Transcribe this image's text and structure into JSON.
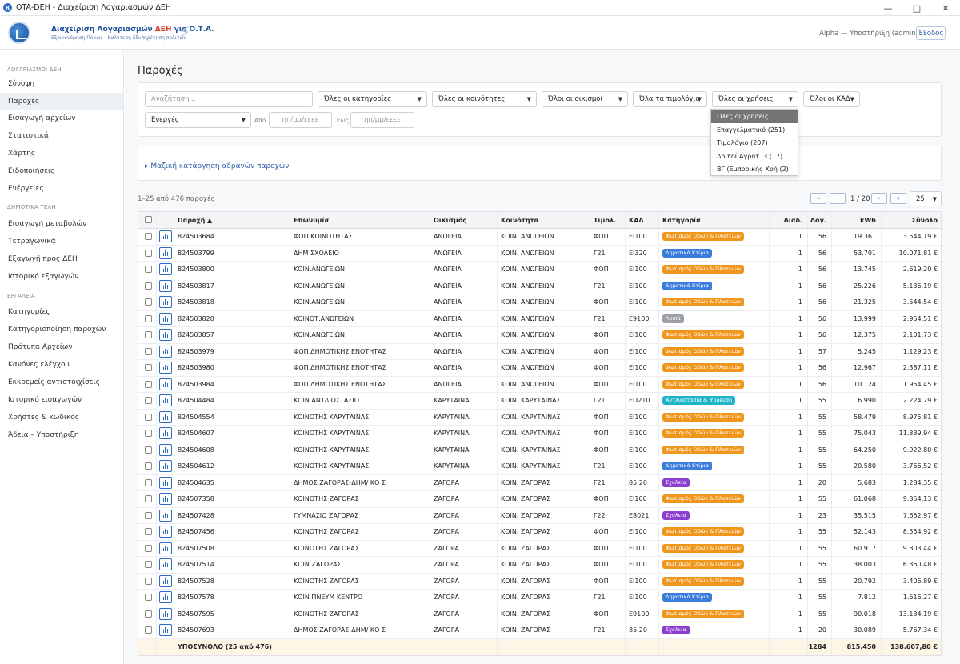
{
  "window": {
    "title": "OTA-DEH - Διαχείριση Λογαριασμών ΔΕΗ"
  },
  "header": {
    "brand_title_a": "Διαχείριση Λογαριασμών ",
    "brand_title_b": "ΔΕΗ",
    "brand_title_c": " για Ο.Τ.Α.",
    "brand_subtitle": "Εξοικονόμηση Πόρων - Καλύτερη Εξυπηρέτηση πολιτών",
    "user": "Alpha — Υποστήριξη (admin)",
    "logout": "Έξοδος"
  },
  "sidebar": {
    "sections": [
      {
        "title": "ΛΟΓΑΡΙΑΣΜΟΙ ΔΕΗ"
      },
      {
        "title": "ΔΗΜΟΤΙΚΑ ΤΕΛΗ"
      },
      {
        "title": "ΕΡΓΑΛΕΙΑ"
      }
    ],
    "items": [
      "Σύνοψη",
      "Παροχές",
      "Εισαγωγή αρχείων",
      "Στατιστικά",
      "Χάρτης",
      "Ειδοποιήσεις",
      "Ενέργειες",
      "Εισαγωγή μεταβολών",
      "Τετραγωνικά",
      "Εξαγωγή προς ΔΕΗ",
      "Ιστορικό εξαγωγών",
      "Κατηγορίες",
      "Κατηγοριοποίηση παροχών",
      "Πρότυπα Αρχείων",
      "Κανόνες ελέγχου",
      "Εκκρεμείς αντιστοιχίσεις",
      "Ιστορικό εισαγωγών",
      "Χρήστες & κωδικός",
      "Άδεια – Υποστήριξη"
    ]
  },
  "page": {
    "title": "Παροχές"
  },
  "filters": {
    "search_placeholder": "Αναζήτηση...",
    "categories": "Όλες οι κατηγορίες",
    "communities": "Όλες οι κοινότητες",
    "settlements": "Όλοι οι οικισμοί",
    "tariffs": "Όλα τα τιμολόγια",
    "uses": "Όλες οι χρήσεις",
    "kad": "Όλοι οι ΚΑΔ",
    "status": "Ενεργές",
    "from_label": "Από",
    "to_label": "Έως",
    "date_placeholder": "ηη/μμ/εεεε"
  },
  "uses_dropdown": [
    "Όλες οι χρήσεις",
    "Επαγγελματικό (251)",
    "Τιμολόγιο (207)",
    "Λοιποί Αγρότ. 3 (17)",
    "ΒΓ (Εμπορικής Χρή (2)"
  ],
  "bulk_link": "▸ Μαζική κατάργηση αδρανών παροχών",
  "listing": {
    "count": "1–25 από 476 παροχές",
    "page": "1 / 20",
    "page_size": "25",
    "first": "«",
    "prev": "‹",
    "next": "›",
    "last": "»"
  },
  "table": {
    "columns": [
      "Παροχή ▲",
      "Επωνυμία",
      "Οικισμός",
      "Κοινότητα",
      "Τιμολ.",
      "ΚΑΔ",
      "Κατηγορία",
      "Διαδ.",
      "Λογ.",
      "kWh",
      "Σύνολο"
    ],
    "rows": [
      [
        "824503684",
        "ΦΟΠ ΚΟΙΝΟΤΗΤΑΣ",
        "ΑΝΩΓΕΙΑ",
        "ΚΟΙΝ. ΑΝΩΓΕΙΩΝ",
        "ΦΟΠ",
        "ΕΙ100",
        "Φωτισμός Οδών & Πλατειών",
        "1",
        "56",
        "19.361",
        "3.544,19 €"
      ],
      [
        "824503799",
        "ΔΗΜ ΣΧΟΛΕΙΟ",
        "ΑΝΩΓΕΙΑ",
        "ΚΟΙΝ. ΑΝΩΓΕΙΩΝ",
        "Γ21",
        "ΕΙ320",
        "Δημοτικά Κτίρια",
        "1",
        "56",
        "53.701",
        "10.071,81 €"
      ],
      [
        "824503800",
        "ΚΟΙΝ.ΑΝΩΓΕΙΩΝ",
        "ΑΝΩΓΕΙΑ",
        "ΚΟΙΝ. ΑΝΩΓΕΙΩΝ",
        "ΦΟΠ",
        "ΕΙ100",
        "Φωτισμός Οδών & Πλατειών",
        "1",
        "56",
        "13.745",
        "2.619,20 €"
      ],
      [
        "824503817",
        "ΚΟΙΝ.ΑΝΩΓΕΙΩΝ",
        "ΑΝΩΓΕΙΑ",
        "ΚΟΙΝ. ΑΝΩΓΕΙΩΝ",
        "Γ21",
        "ΕΙ100",
        "Δημοτικά Κτίρια",
        "1",
        "56",
        "25.226",
        "5.136,19 €"
      ],
      [
        "824503818",
        "ΚΟΙΝ.ΑΝΩΓΕΙΩΝ",
        "ΑΝΩΓΕΙΑ",
        "ΚΟΙΝ. ΑΝΩΓΕΙΩΝ",
        "ΦΟΠ",
        "ΕΙ100",
        "Φωτισμός Οδών & Πλατειών",
        "1",
        "56",
        "21.325",
        "3.544,54 €"
      ],
      [
        "824503820",
        "ΚΟΙΝΟΤ.ΑΝΩΓΕΙΩΝ",
        "ΑΝΩΓΕΙΑ",
        "ΚΟΙΝ. ΑΝΩΓΕΙΩΝ",
        "Γ21",
        "Ε9100",
        "Λοιπά",
        "1",
        "56",
        "13.999",
        "2.954,51 €"
      ],
      [
        "824503857",
        "ΚΟΙΝ.ΑΝΩΓΕΙΩΝ",
        "ΑΝΩΓΕΙΑ",
        "ΚΟΙΝ. ΑΝΩΓΕΙΩΝ",
        "ΦΟΠ",
        "ΕΙ100",
        "Φωτισμός Οδών & Πλατειών",
        "1",
        "56",
        "12.375",
        "2.101,73 €"
      ],
      [
        "824503979",
        "ΦΟΠ ΔΗΜΟΤΙΚΗΣ ΕΝΟΤΗΤΑΣ",
        "ΑΝΩΓΕΙΑ",
        "ΚΟΙΝ. ΑΝΩΓΕΙΩΝ",
        "ΦΟΠ",
        "ΕΙ100",
        "Φωτισμός Οδών & Πλατειών",
        "1",
        "57",
        "5.245",
        "1.129,23 €"
      ],
      [
        "824503980",
        "ΦΟΠ ΔΗΜΟΤΙΚΗΣ ΕΝΟΤΗΤΑΣ",
        "ΑΝΩΓΕΙΑ",
        "ΚΟΙΝ. ΑΝΩΓΕΙΩΝ",
        "ΦΟΠ",
        "ΕΙ100",
        "Φωτισμός Οδών & Πλατειών",
        "1",
        "56",
        "12.967",
        "2.387,11 €"
      ],
      [
        "824503984",
        "ΦΟΠ ΔΗΜΟΤΙΚΗΣ ΕΝΟΤΗΤΑΣ",
        "ΑΝΩΓΕΙΑ",
        "ΚΟΙΝ. ΑΝΩΓΕΙΩΝ",
        "ΦΟΠ",
        "ΕΙ100",
        "Φωτισμός Οδών & Πλατειών",
        "1",
        "56",
        "10.124",
        "1.954,45 €"
      ],
      [
        "824504484",
        "ΚΟΙΝ ΑΝΤΛΙΟΣΤΑΣΙΟ",
        "ΚΑΡΥΤΑΙΝΑ",
        "ΚΟΙΝ. ΚΑΡΥΤΑΙΝΑΣ",
        "Γ21",
        "ΕD210",
        "Αντλιοστάσια & Ύδρευση",
        "1",
        "55",
        "6.990",
        "2.224,79 €"
      ],
      [
        "824504554",
        "ΚΟΙΝΟΤΗΣ ΚΑΡΥΤΑΙΝΑΣ",
        "ΚΑΡΥΤΑΙΝΑ",
        "ΚΟΙΝ. ΚΑΡΥΤΑΙΝΑΣ",
        "ΦΟΠ",
        "ΕΙ100",
        "Φωτισμός Οδών & Πλατειών",
        "1",
        "55",
        "58.479",
        "8.975,81 €"
      ],
      [
        "824504607",
        "ΚΟΙΝΟΤΗΣ ΚΑΡΥΤΑΙΝΑΣ",
        "ΚΑΡΥΤΑΙΝΑ",
        "ΚΟΙΝ. ΚΑΡΥΤΑΙΝΑΣ",
        "ΦΟΠ",
        "ΕΙ100",
        "Φωτισμός Οδών & Πλατειών",
        "1",
        "55",
        "75.043",
        "11.339,94 €"
      ],
      [
        "824504608",
        "ΚΟΙΝΟΤΗΣ ΚΑΡΥΤΑΙΝΑΣ",
        "ΚΑΡΥΤΑΙΝΑ",
        "ΚΟΙΝ. ΚΑΡΥΤΑΙΝΑΣ",
        "ΦΟΠ",
        "ΕΙ100",
        "Φωτισμός Οδών & Πλατειών",
        "1",
        "55",
        "64.250",
        "9.922,80 €"
      ],
      [
        "824504612",
        "ΚΟΙΝΟΤΗΣ ΚΑΡΥΤΑΙΝΑΣ",
        "ΚΑΡΥΤΑΙΝΑ",
        "ΚΟΙΝ. ΚΑΡΥΤΑΙΝΑΣ",
        "Γ21",
        "ΕΙ100",
        "Δημοτικά Κτίρια",
        "1",
        "55",
        "20.580",
        "3.766,52 €"
      ],
      [
        "824504635",
        "ΔΗΜΟΣ ΖΑΓΟΡΑΣ-ΔΗΜ/ ΚΟ Σ",
        "ΖΑΓΟΡΑ",
        "ΚΟΙΝ. ΖΑΓΟΡΑΣ",
        "Γ21",
        "85.20",
        "Σχολεία",
        "1",
        "20",
        "5.683",
        "1.284,35 €"
      ],
      [
        "824507358",
        "ΚΟΙΝΟΤΗΣ ΖΑΓΟΡΑΣ",
        "ΖΑΓΟΡΑ",
        "ΚΟΙΝ. ΖΑΓΟΡΑΣ",
        "ΦΟΠ",
        "ΕΙ100",
        "Φωτισμός Οδών & Πλατειών",
        "1",
        "55",
        "61.068",
        "9.354,13 €"
      ],
      [
        "824507428",
        "ΓΥΜΝΑΣΙΟ ΖΑΓΟΡΑΣ",
        "ΖΑΓΟΡΑ",
        "ΚΟΙΝ. ΖΑΓΟΡΑΣ",
        "Γ22",
        "Ε8021",
        "Σχολεία",
        "1",
        "23",
        "35.515",
        "7.652,97 €"
      ],
      [
        "824507456",
        "ΚΟΙΝΟΤΗΣ ΖΑΓΟΡΑΣ",
        "ΖΑΓΟΡΑ",
        "ΚΟΙΝ. ΖΑΓΟΡΑΣ",
        "ΦΟΠ",
        "ΕΙ100",
        "Φωτισμός Οδών & Πλατειών",
        "1",
        "55",
        "52.143",
        "8.554,92 €"
      ],
      [
        "824507508",
        "ΚΟΙΝΟΤΗΣ ΖΑΓΟΡΑΣ",
        "ΖΑΓΟΡΑ",
        "ΚΟΙΝ. ΖΑΓΟΡΑΣ",
        "ΦΟΠ",
        "ΕΙ100",
        "Φωτισμός Οδών & Πλατειών",
        "1",
        "55",
        "60.917",
        "9.803,44 €"
      ],
      [
        "824507514",
        "ΚΟΙΝ ΖΑΓΟΡΑΣ",
        "ΖΑΓΟΡΑ",
        "ΚΟΙΝ. ΖΑΓΟΡΑΣ",
        "ΦΟΠ",
        "ΕΙ100",
        "Φωτισμός Οδών & Πλατειών",
        "1",
        "55",
        "38.003",
        "6.360,48 €"
      ],
      [
        "824507528",
        "ΚΟΙΝΟΤΗΣ ΖΑΓΟΡΑΣ",
        "ΖΑΓΟΡΑ",
        "ΚΟΙΝ. ΖΑΓΟΡΑΣ",
        "ΦΟΠ",
        "ΕΙ100",
        "Φωτισμός Οδών & Πλατειών",
        "1",
        "55",
        "20.792",
        "3.406,89 €"
      ],
      [
        "824507578",
        "ΚΟΙΝ ΠΝΕΥΜ ΚΕΝΤΡΟ",
        "ΖΑΓΟΡΑ",
        "ΚΟΙΝ. ΖΑΓΟΡΑΣ",
        "Γ21",
        "ΕΙ100",
        "Δημοτικά Κτίρια",
        "1",
        "55",
        "7.812",
        "1.616,27 €"
      ],
      [
        "824507595",
        "ΚΟΙΝΟΤΗΣ ΖΑΓΟΡΑΣ",
        "ΖΑΓΟΡΑ",
        "ΚΟΙΝ. ΖΑΓΟΡΑΣ",
        "ΦΟΠ",
        "Ε9100",
        "Φωτισμός Οδών & Πλατειών",
        "1",
        "55",
        "90.018",
        "13.134,19 €"
      ],
      [
        "824507693",
        "ΔΗΜΟΣ ΖΑΓΟΡΑΣ-ΔΗΜ/ ΚΟ Σ",
        "ΖΑΓΟΡΑ",
        "ΚΟΙΝ. ΖΑΓΟΡΑΣ",
        "Γ21",
        "85.20",
        "Σχολεία",
        "1",
        "20",
        "30.089",
        "5.767,34 €"
      ]
    ],
    "footer": {
      "label": "ΥΠΟΣΥΝΟΛΟ (25 από 476)",
      "log": "1284",
      "kwh": "815.450",
      "total": "138.607,80 €"
    }
  },
  "category_colors": {
    "Φωτισμός Οδών & Πλατειών": "#f0961c",
    "Δημοτικά Κτίρια": "#3b7ddd",
    "Λοιπά": "#9aa0a6",
    "Αντλιοστάσια & Ύδρευση": "#1fb5c9",
    "Σχολεία": "#8a3fd1"
  }
}
